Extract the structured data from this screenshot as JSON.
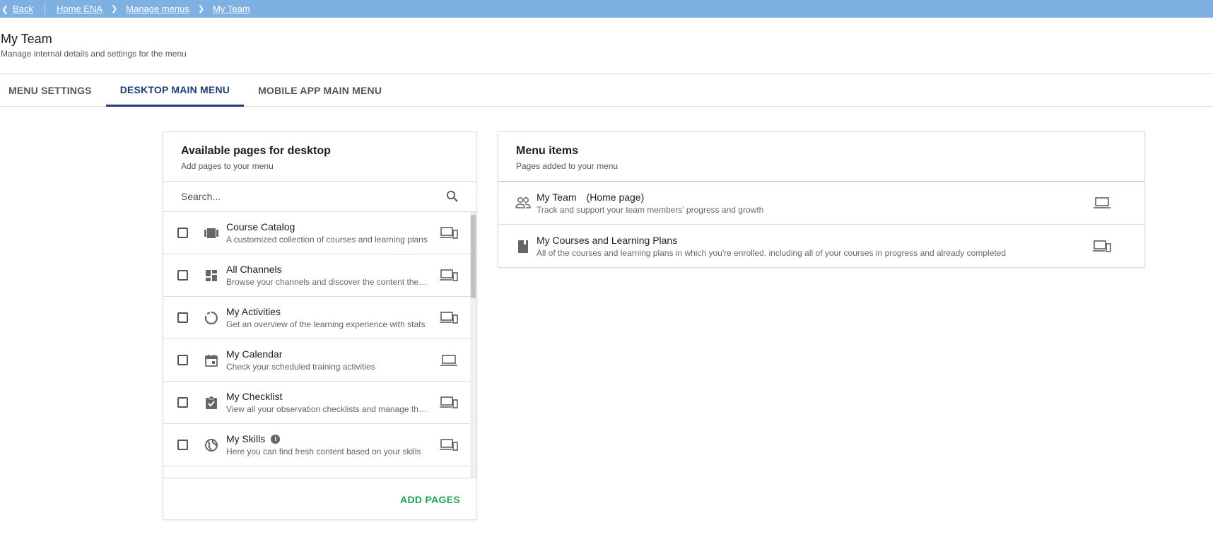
{
  "topbar": {
    "back_label": "Back",
    "breadcrumb": [
      "Home ENA",
      "Manage menus",
      "My Team"
    ]
  },
  "header": {
    "title": "My Team",
    "subtitle": "Manage internal details and settings for the menu"
  },
  "tabs": [
    {
      "label": "MENU SETTINGS",
      "active": false
    },
    {
      "label": "DESKTOP MAIN MENU",
      "active": true
    },
    {
      "label": "MOBILE APP MAIN MENU",
      "active": false
    }
  ],
  "available": {
    "title": "Available pages for desktop",
    "subtitle": "Add pages to your menu",
    "search_placeholder": "Search...",
    "items": [
      {
        "icon": "catalog-icon",
        "title": "Course Catalog",
        "desc": "A customized collection of courses and learning plans",
        "device": "desktop-mobile-icon"
      },
      {
        "icon": "dashboard-icon",
        "title": "All Channels",
        "desc": "Browse your channels and discover the content they include",
        "device": "desktop-mobile-icon"
      },
      {
        "icon": "activity-icon",
        "title": "My Activities",
        "desc": "Get an overview of the learning experience with stats",
        "device": "desktop-mobile-icon"
      },
      {
        "icon": "calendar-icon",
        "title": "My Calendar",
        "desc": "Check your scheduled training activities",
        "device": "laptop-icon"
      },
      {
        "icon": "checklist-icon",
        "title": "My Checklist",
        "desc": "View all your observation checklists and manage them",
        "device": "desktop-mobile-icon"
      },
      {
        "icon": "globe-icon",
        "title": "My Skills",
        "desc": "Here you can find fresh content based on your skills",
        "device": "desktop-mobile-icon",
        "info": true
      }
    ],
    "add_button": "ADD PAGES"
  },
  "menu_items": {
    "title": "Menu items",
    "subtitle": "Pages added to your menu",
    "items": [
      {
        "icon": "team-icon",
        "title": "My Team",
        "tag": "(Home page)",
        "desc": "Track and support your team members' progress and growth",
        "device": "laptop-icon"
      },
      {
        "icon": "book-icon",
        "title": "My Courses and Learning Plans",
        "tag": "",
        "desc": "All of the courses and learning plans in which you're enrolled, including all of your courses in progress and already completed",
        "device": "desktop-mobile-icon"
      }
    ]
  }
}
